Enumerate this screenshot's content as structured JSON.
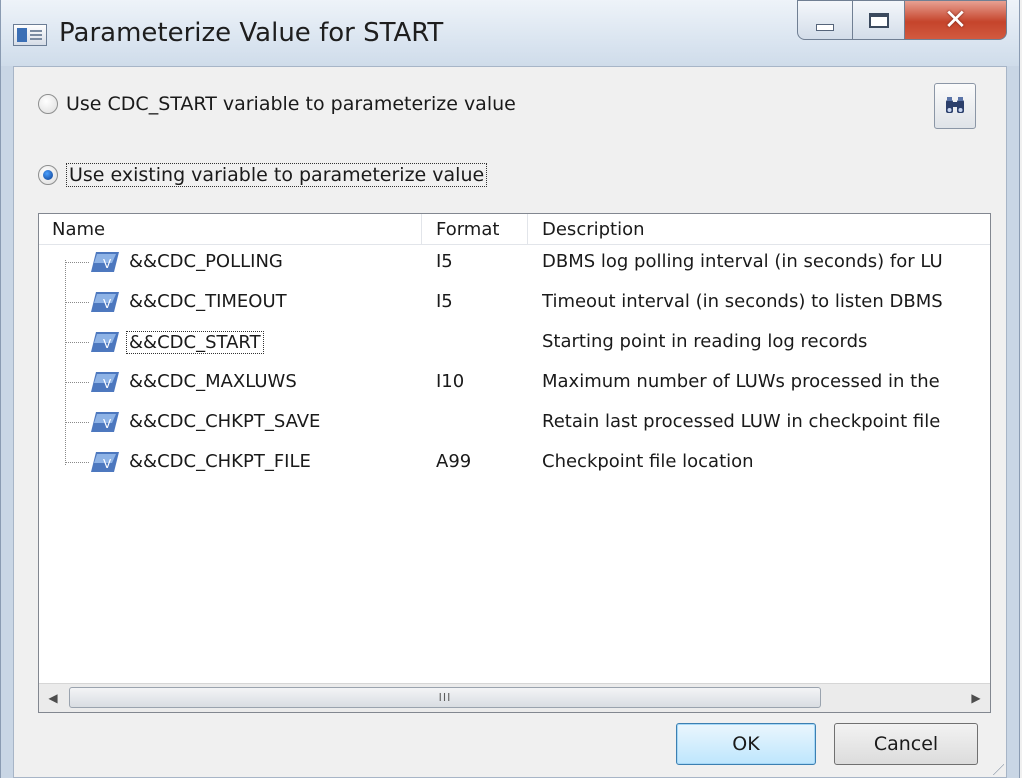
{
  "window": {
    "title": "Parameterize Value for START"
  },
  "options": {
    "cdc_start": "Use CDC_START variable to parameterize value",
    "existing": "Use existing variable to parameterize value",
    "selected": "existing"
  },
  "table": {
    "columns": {
      "name": "Name",
      "format": "Format",
      "description": "Description"
    },
    "rows": [
      {
        "name": "&&CDC_POLLING",
        "format": "I5",
        "description": "DBMS log polling interval (in seconds) for LU"
      },
      {
        "name": "&&CDC_TIMEOUT",
        "format": "I5",
        "description": "Timeout interval (in seconds) to listen DBMS"
      },
      {
        "name": "&&CDC_START",
        "format": "",
        "description": "Starting point in reading log records"
      },
      {
        "name": "&&CDC_MAXLUWS",
        "format": "I10",
        "description": "Maximum number of LUWs processed in the"
      },
      {
        "name": "&&CDC_CHKPT_SAVE",
        "format": "",
        "description": "Retain last processed LUW in checkpoint file"
      },
      {
        "name": "&&CDC_CHKPT_FILE",
        "format": "A99",
        "description": "Checkpoint file location"
      }
    ],
    "icon_glyph": "V",
    "scroll_thumb_label": "III"
  },
  "buttons": {
    "ok": "OK",
    "cancel": "Cancel"
  }
}
